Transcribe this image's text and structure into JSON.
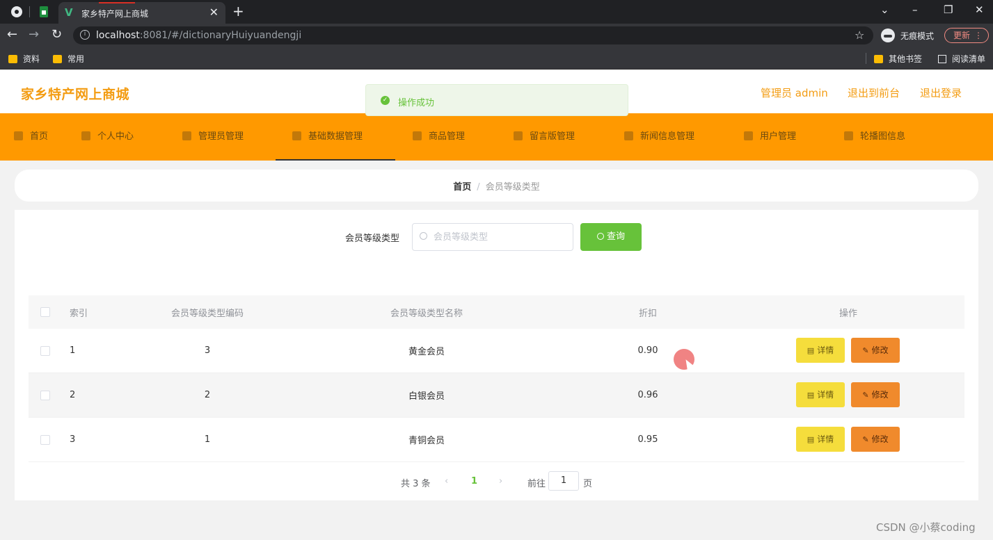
{
  "browser": {
    "tab_title": "家乡特产网上商城",
    "tab_close": "✕",
    "new_tab": "+",
    "url_host": "localhost",
    "url_rest": ":8081/#/dictionaryHuiyuandengji",
    "incognito_label": "无痕模式",
    "update_label": "更新",
    "bookmarks": [
      "资料",
      "常用"
    ],
    "other_bookmarks": "其他书签",
    "reading_list": "阅读清单"
  },
  "header": {
    "site_title": "家乡特产网上商城",
    "admin_label": "管理员 admin",
    "back_front": "退出到前台",
    "logout": "退出登录"
  },
  "toast": {
    "message": "操作成功"
  },
  "nav": {
    "items": [
      {
        "label": "首页",
        "icon": "home-icon"
      },
      {
        "label": "个人中心",
        "icon": "user-icon"
      },
      {
        "label": "管理员管理",
        "icon": "admin-icon"
      },
      {
        "label": "基础数据管理",
        "icon": "data-icon"
      },
      {
        "label": "商品管理",
        "icon": "goods-icon"
      },
      {
        "label": "留言版管理",
        "icon": "message-icon"
      },
      {
        "label": "新闻信息管理",
        "icon": "news-icon"
      },
      {
        "label": "用户管理",
        "icon": "users-icon"
      },
      {
        "label": "轮播图信息",
        "icon": "carousel-icon"
      }
    ],
    "active_index": 3
  },
  "breadcrumb": {
    "home": "首页",
    "separator": "/",
    "current": "会员等级类型"
  },
  "search": {
    "label": "会员等级类型",
    "placeholder": "会员等级类型",
    "value": "",
    "button_label": "查询"
  },
  "table": {
    "headers": [
      "索引",
      "会员等级类型编码",
      "会员等级类型名称",
      "折扣",
      "操作"
    ],
    "rows": [
      {
        "index": "1",
        "code": "3",
        "name": "黄金会员",
        "discount": "0.90"
      },
      {
        "index": "2",
        "code": "2",
        "name": "白银会员",
        "discount": "0.96"
      },
      {
        "index": "3",
        "code": "1",
        "name": "青铜会员",
        "discount": "0.95"
      }
    ],
    "detail_label": "详情",
    "edit_label": "修改"
  },
  "pagination": {
    "total": "共 3 条",
    "prev": "‹",
    "current_page": "1",
    "next": "›",
    "goto_label": "前往",
    "goto_value": "1",
    "page_suffix": "页"
  },
  "watermark": "CSDN @小蔡coding",
  "colors": {
    "accent": "#ff9900",
    "title": "#f39c12",
    "success": "#67c23a",
    "detail_button": "#f5dd3c",
    "edit_button": "#f08a2c"
  }
}
